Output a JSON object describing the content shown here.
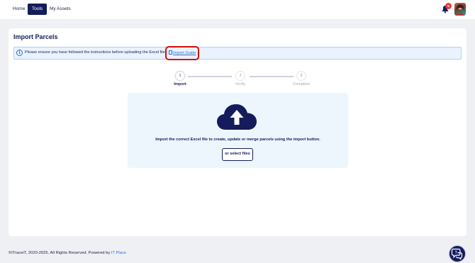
{
  "nav": {
    "items": [
      {
        "label": "Home",
        "active": false
      },
      {
        "label": "Tools",
        "active": true
      },
      {
        "label": "My Assets",
        "active": false
      }
    ],
    "notification_count": "5"
  },
  "page": {
    "title": "Import Parcels",
    "info_text": "Please ensure you have followed the instructions before uploading the Excel file",
    "guide_link": "Import Guide"
  },
  "stepper": {
    "steps": [
      {
        "number": "1",
        "label": "Import",
        "active": true
      },
      {
        "number": "2",
        "label": "Verify",
        "active": false
      },
      {
        "number": "3",
        "label": "Complete",
        "active": false
      }
    ]
  },
  "upload": {
    "instruction": "Import the correct Excel file to create, update or merge parcels using the import button.",
    "button_label": "or select files"
  },
  "footer": {
    "copyright": "©ITraceiT, 2020-2025. All Rights Reserved. Powered by ",
    "powered_link": "IT Place"
  },
  "colors": {
    "brand_navy": "#141c5c",
    "highlight_red": "#d40d0d",
    "info_blue": "#2f6fcc",
    "badge_red": "#e53935"
  }
}
